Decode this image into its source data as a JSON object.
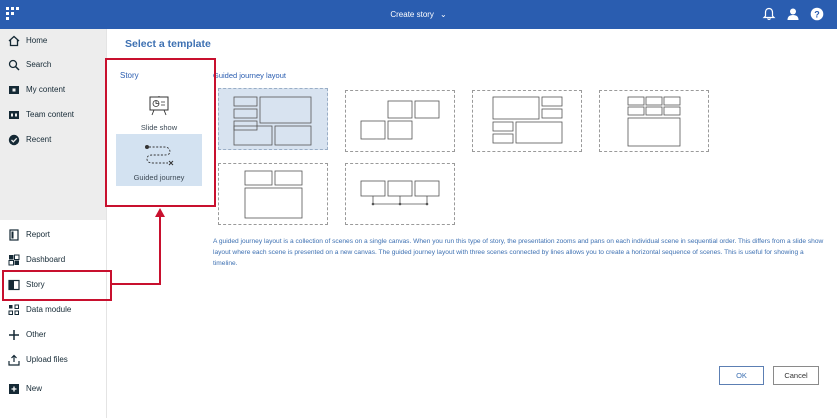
{
  "topbar": {
    "title": "Create story",
    "title_chevron": "chevron-down-icon",
    "icons": [
      "app-logo",
      "notification-icon",
      "user-icon",
      "help-icon"
    ],
    "color": "#2a5db0"
  },
  "leftnav": {
    "top_items": [
      {
        "label": "Home",
        "icon": "home-icon"
      },
      {
        "label": "Search",
        "icon": "search-icon"
      },
      {
        "label": "My content",
        "icon": "folder-icon"
      },
      {
        "label": "Team content",
        "icon": "team-folder-icon"
      },
      {
        "label": "Recent",
        "icon": "clock-icon"
      }
    ],
    "bottom_items": [
      {
        "label": "Report",
        "icon": "report-icon"
      },
      {
        "label": "Dashboard",
        "icon": "dashboard-icon"
      },
      {
        "label": "Story",
        "icon": "story-icon"
      },
      {
        "label": "Data module",
        "icon": "data-module-icon"
      },
      {
        "label": "Other",
        "icon": "plus-icon"
      },
      {
        "label": "Upload files",
        "icon": "upload-icon"
      },
      {
        "label": "New",
        "icon": "new-icon"
      }
    ]
  },
  "main": {
    "title": "Select a template",
    "story_panel": {
      "label": "Story",
      "options": [
        {
          "label": "Slide show",
          "icon": "slide-show-icon",
          "selected": false
        },
        {
          "label": "Guided journey",
          "icon": "guided-journey-icon",
          "selected": true
        }
      ]
    },
    "layouts_label": "Guided journey layout",
    "selected_layout": 1,
    "description": "A guided journey layout is a collection of scenes on a single canvas. When you run this type of story, the presentation zooms and pans on each individual scene in sequential order. This differs from a slide show layout where each scene is presented on a new canvas. The guided journey layout with three scenes connected by lines allows you to create a horizontal sequence of scenes. This is useful for showing a timeline."
  },
  "buttons": {
    "ok": "OK",
    "cancel": "Cancel"
  },
  "colors": {
    "accent": "#3d70b2",
    "annotation": "#c8102e",
    "selected_bg": "#d3e2f1"
  }
}
